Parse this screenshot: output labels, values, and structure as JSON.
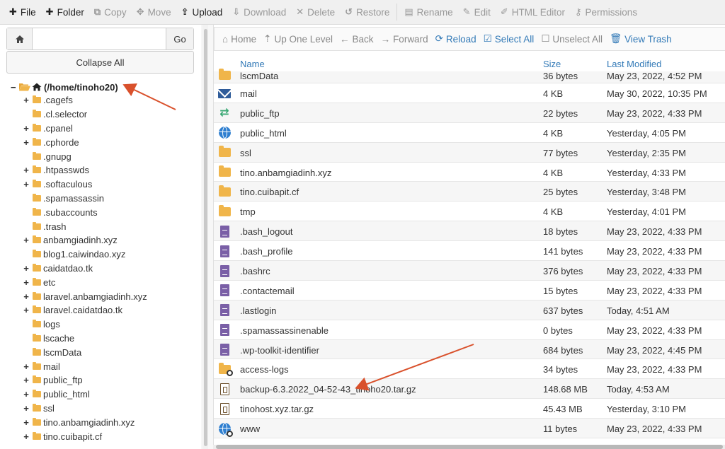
{
  "toolbar": {
    "items": [
      {
        "label": "File",
        "icon": "plus",
        "enabled": true
      },
      {
        "label": "Folder",
        "icon": "plus",
        "enabled": true
      },
      {
        "label": "Copy",
        "icon": "copy",
        "enabled": false
      },
      {
        "label": "Move",
        "icon": "move",
        "enabled": false
      },
      {
        "label": "Upload",
        "icon": "upload",
        "enabled": true
      },
      {
        "label": "Download",
        "icon": "download",
        "enabled": false
      },
      {
        "label": "Delete",
        "icon": "x",
        "enabled": false
      },
      {
        "label": "Restore",
        "icon": "undo",
        "enabled": false
      },
      {
        "label": "Rename",
        "icon": "file",
        "enabled": false
      },
      {
        "label": "Edit",
        "icon": "pencil",
        "enabled": false
      },
      {
        "label": "HTML Editor",
        "icon": "edit",
        "enabled": false
      },
      {
        "label": "Permissions",
        "icon": "key",
        "enabled": false
      }
    ]
  },
  "left": {
    "path_value": "",
    "go_label": "Go",
    "collapse_label": "Collapse All",
    "root_label": "(/home/tinoho20)",
    "tree": [
      {
        "label": ".cagefs",
        "expandable": true
      },
      {
        "label": ".cl.selector",
        "expandable": false
      },
      {
        "label": ".cpanel",
        "expandable": true
      },
      {
        "label": ".cphorde",
        "expandable": true
      },
      {
        "label": ".gnupg",
        "expandable": false
      },
      {
        "label": ".htpasswds",
        "expandable": true
      },
      {
        "label": ".softaculous",
        "expandable": true
      },
      {
        "label": ".spamassassin",
        "expandable": false
      },
      {
        "label": ".subaccounts",
        "expandable": false
      },
      {
        "label": ".trash",
        "expandable": false
      },
      {
        "label": "anbamgiadinh.xyz",
        "expandable": true
      },
      {
        "label": "blog1.caiwindao.xyz",
        "expandable": false
      },
      {
        "label": "caidatdao.tk",
        "expandable": true
      },
      {
        "label": "etc",
        "expandable": true
      },
      {
        "label": "laravel.anbamgiadinh.xyz",
        "expandable": true
      },
      {
        "label": "laravel.caidatdao.tk",
        "expandable": true
      },
      {
        "label": "logs",
        "expandable": false
      },
      {
        "label": "lscache",
        "expandable": false
      },
      {
        "label": "lscmData",
        "expandable": false
      },
      {
        "label": "mail",
        "expandable": true
      },
      {
        "label": "public_ftp",
        "expandable": true
      },
      {
        "label": "public_html",
        "expandable": true
      },
      {
        "label": "ssl",
        "expandable": true
      },
      {
        "label": "tino.anbamgiadinh.xyz",
        "expandable": true
      },
      {
        "label": "tino.cuibapit.cf",
        "expandable": true
      }
    ]
  },
  "right": {
    "actions": [
      {
        "label": "Home",
        "icon": "home",
        "style": "gray"
      },
      {
        "label": "Up One Level",
        "icon": "up",
        "style": "gray"
      },
      {
        "label": "Back",
        "icon": "left",
        "style": "gray"
      },
      {
        "label": "Forward",
        "icon": "right",
        "style": "gray"
      },
      {
        "label": "Reload",
        "icon": "reload",
        "style": "blue"
      },
      {
        "label": "Select All",
        "icon": "check",
        "style": "blue"
      },
      {
        "label": "Unselect All",
        "icon": "box",
        "style": "gray"
      },
      {
        "label": "View Trash",
        "icon": "trash",
        "style": "blue"
      }
    ],
    "columns": {
      "name": "Name",
      "size": "Size",
      "modified": "Last Modified"
    },
    "files": [
      {
        "icon": "folder",
        "name": "lscmData",
        "size": "36 bytes",
        "modified": "May 23, 2022, 4:52 PM"
      },
      {
        "icon": "mail",
        "name": "mail",
        "size": "4 KB",
        "modified": "May 30, 2022, 10:35 PM"
      },
      {
        "icon": "ftp",
        "name": "public_ftp",
        "size": "22 bytes",
        "modified": "May 23, 2022, 4:33 PM"
      },
      {
        "icon": "globe",
        "name": "public_html",
        "size": "4 KB",
        "modified": "Yesterday, 4:05 PM"
      },
      {
        "icon": "folder",
        "name": "ssl",
        "size": "77 bytes",
        "modified": "Yesterday, 2:35 PM"
      },
      {
        "icon": "folder",
        "name": "tino.anbamgiadinh.xyz",
        "size": "4 KB",
        "modified": "Yesterday, 4:33 PM"
      },
      {
        "icon": "folder",
        "name": "tino.cuibapit.cf",
        "size": "25 bytes",
        "modified": "Yesterday, 3:48 PM"
      },
      {
        "icon": "folder",
        "name": "tmp",
        "size": "4 KB",
        "modified": "Yesterday, 4:01 PM"
      },
      {
        "icon": "doc",
        "name": ".bash_logout",
        "size": "18 bytes",
        "modified": "May 23, 2022, 4:33 PM"
      },
      {
        "icon": "doc",
        "name": ".bash_profile",
        "size": "141 bytes",
        "modified": "May 23, 2022, 4:33 PM"
      },
      {
        "icon": "doc",
        "name": ".bashrc",
        "size": "376 bytes",
        "modified": "May 23, 2022, 4:33 PM"
      },
      {
        "icon": "doc",
        "name": ".contactemail",
        "size": "15 bytes",
        "modified": "May 23, 2022, 4:33 PM"
      },
      {
        "icon": "doc",
        "name": ".lastlogin",
        "size": "637 bytes",
        "modified": "Today, 4:51 AM"
      },
      {
        "icon": "doc",
        "name": ".spamassassinenable",
        "size": "0 bytes",
        "modified": "May 23, 2022, 4:33 PM"
      },
      {
        "icon": "doc",
        "name": ".wp-toolkit-identifier",
        "size": "684 bytes",
        "modified": "May 23, 2022, 4:45 PM"
      },
      {
        "icon": "folder-link",
        "name": "access-logs",
        "size": "34 bytes",
        "modified": "May 23, 2022, 4:33 PM"
      },
      {
        "icon": "zip",
        "name": "backup-6.3.2022_04-52-43_tinoho20.tar.gz",
        "size": "148.68 MB",
        "modified": "Today, 4:53 AM"
      },
      {
        "icon": "zip",
        "name": "tinohost.xyz.tar.gz",
        "size": "45.43 MB",
        "modified": "Yesterday, 3:10 PM"
      },
      {
        "icon": "globe-link",
        "name": "www",
        "size": "11 bytes",
        "modified": "May 23, 2022, 4:33 PM"
      }
    ]
  },
  "colors": {
    "accent": "#337ab7",
    "folder": "#f0b54a",
    "arrow": "#d9512c"
  }
}
